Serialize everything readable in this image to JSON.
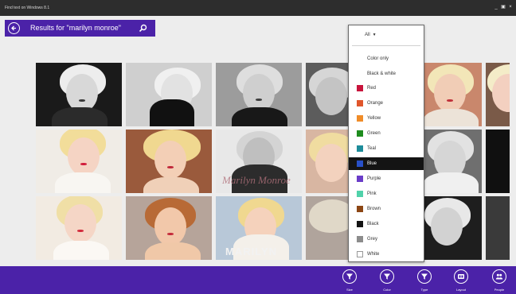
{
  "window": {
    "title": "Find text on Windows 8.1",
    "controls": [
      "_",
      "▣",
      "×"
    ]
  },
  "header": {
    "results_text": "Results for \"marilyn monroe\""
  },
  "color_filter": {
    "all_label": "All",
    "options": [
      {
        "label": "Color only",
        "swatch": null,
        "selected": false
      },
      {
        "label": "Black & white",
        "swatch": null,
        "selected": false
      },
      {
        "label": "Red",
        "swatch": "#c8143c",
        "selected": false
      },
      {
        "label": "Orange",
        "swatch": "#e0562b",
        "selected": false
      },
      {
        "label": "Yellow",
        "swatch": "#f08c28",
        "selected": false
      },
      {
        "label": "Green",
        "swatch": "#1e8c1e",
        "selected": false
      },
      {
        "label": "Teal",
        "swatch": "#1e8c9a",
        "selected": false
      },
      {
        "label": "Blue",
        "swatch": "#2850c8",
        "selected": true
      },
      {
        "label": "Purple",
        "swatch": "#6a3cc8",
        "selected": false
      },
      {
        "label": "Pink",
        "swatch": "#50d2aa",
        "selected": false
      },
      {
        "label": "Brown",
        "swatch": "#8c4614",
        "selected": false
      },
      {
        "label": "Black",
        "swatch": "#141414",
        "selected": false
      },
      {
        "label": "Grey",
        "swatch": "#8c8c8c",
        "selected": false
      },
      {
        "label": "White",
        "swatch": "#ffffff",
        "selected": false
      }
    ]
  },
  "image_captions": {
    "signature": "Marilyn Monroe",
    "name_overlay": "MARILYN"
  },
  "app_bar": {
    "buttons": [
      {
        "label": "Size",
        "icon": "filter-icon"
      },
      {
        "label": "Color",
        "icon": "filter-icon"
      },
      {
        "label": "Type",
        "icon": "filter-icon"
      },
      {
        "label": "Layout",
        "icon": "layout-icon"
      },
      {
        "label": "People",
        "icon": "people-icon"
      }
    ]
  },
  "colors": {
    "accent": "#4b22a8",
    "titlebar": "#2d2d2d",
    "selection": "#141414"
  }
}
